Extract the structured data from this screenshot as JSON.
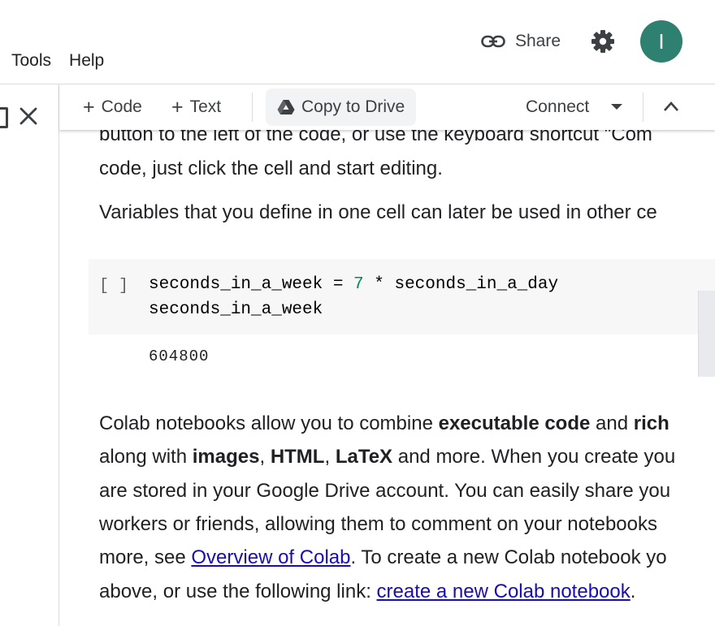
{
  "menu": {
    "tools": "Tools",
    "help": "Help"
  },
  "header": {
    "share_label": "Share",
    "avatar_initial": "I",
    "avatar_color": "#2e8070"
  },
  "toolbar": {
    "add_code": "Code",
    "add_text": "Text",
    "copy_to_drive": "Copy to Drive",
    "connect": "Connect"
  },
  "text_cell_1": {
    "line1": "button to the left of the code, or use the keyboard shortcut \"Com",
    "line2": "code, just click the cell and start editing.",
    "line3": "Variables that you define in one cell can later be used in other ce"
  },
  "code_cell": {
    "run_bracket": "[ ]",
    "line1_var": "seconds_in_a_week = ",
    "line1_num": "7",
    "line1_rest": " * seconds_in_a_day",
    "line2": "seconds_in_a_week",
    "output": "604800"
  },
  "text_cell_2": {
    "p1_a": "Colab notebooks allow you to combine ",
    "p1_b": "executable code",
    "p1_c": " and ",
    "p1_d": "rich",
    "p2_a": "along with ",
    "p2_b": "images",
    "p2_c": ", ",
    "p2_d": "HTML",
    "p2_e": ", ",
    "p2_f": "LaTeX",
    "p2_g": " and more. When you create you",
    "p3": "are stored in your Google Drive account. You can easily share you",
    "p4": "workers or friends, allowing them to comment on your notebooks",
    "p5_a": "more, see ",
    "p5_link": "Overview of Colab",
    "p5_b": ". To create a new Colab notebook yo",
    "p6_a": "above, or use the following link: ",
    "p6_link": "create a new Colab notebook",
    "p6_b": "."
  }
}
